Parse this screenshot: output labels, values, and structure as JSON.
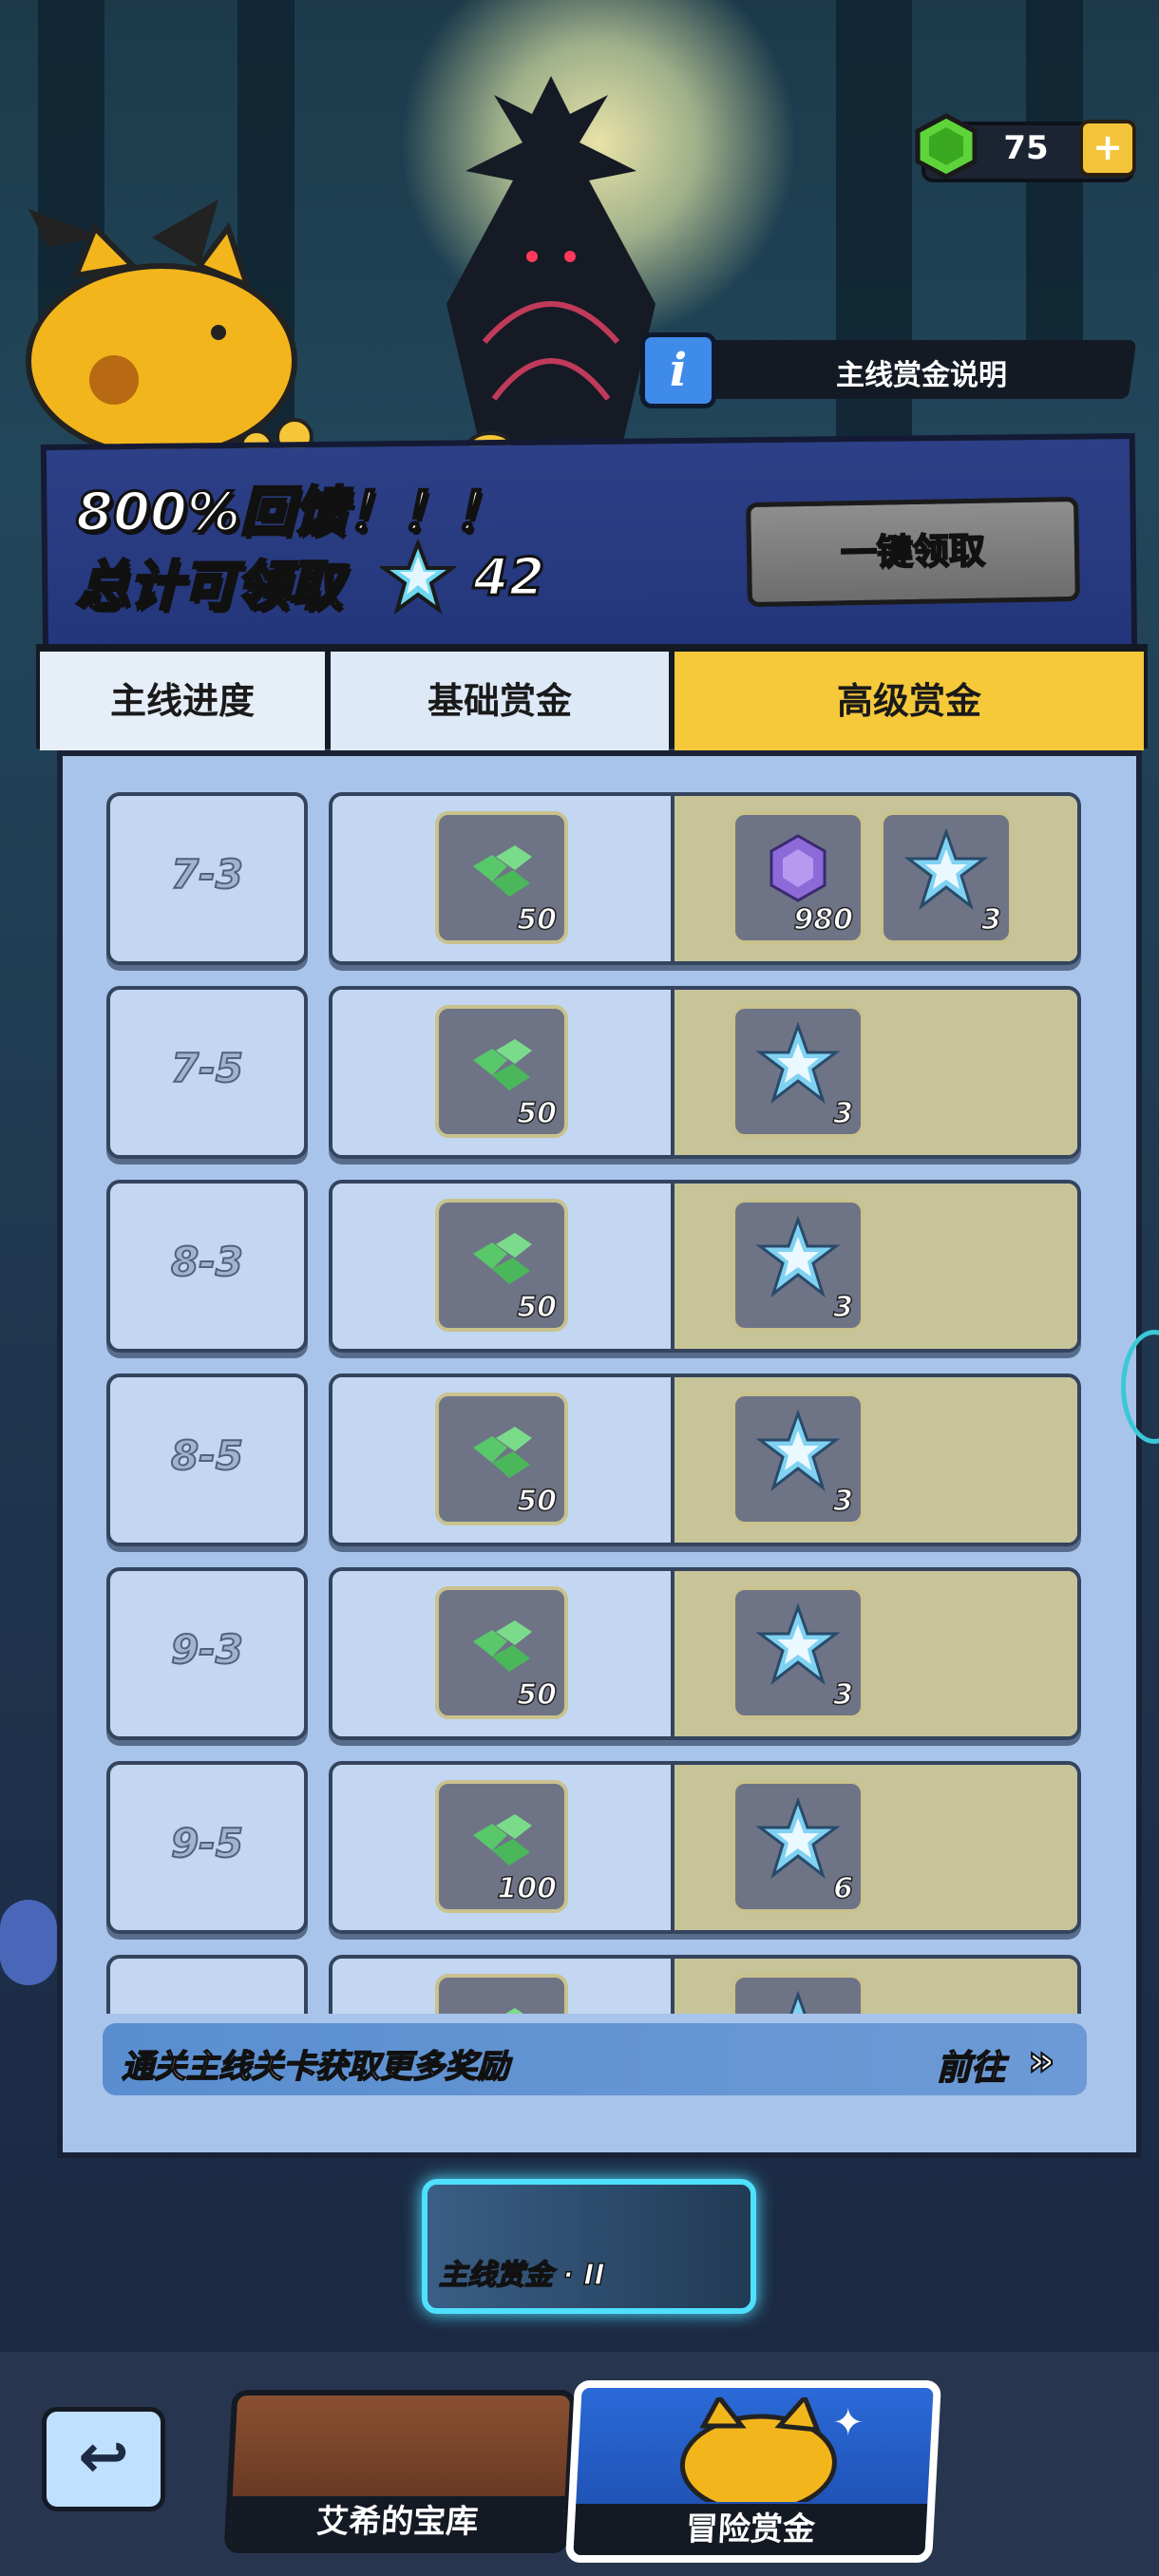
{
  "currency": {
    "gem_count": "75",
    "add_icon": "plus-icon"
  },
  "info": {
    "label": "主线赏金说明",
    "icon": "info-icon"
  },
  "header": {
    "headline": "800%回馈！！！",
    "total_label": "总计可领取",
    "total_value": "42",
    "claim_button": "一键领取"
  },
  "tabs": [
    {
      "label": "主线进度"
    },
    {
      "label": "基础赏金"
    },
    {
      "label": "高级赏金"
    }
  ],
  "rows": [
    {
      "stage": "7-3",
      "basic": [
        {
          "icon": "green-gem-icon",
          "count": "50"
        }
      ],
      "advanced": [
        {
          "icon": "purple-rune-icon",
          "count": "980"
        },
        {
          "icon": "crystal-star-icon",
          "count": "3"
        }
      ]
    },
    {
      "stage": "7-5",
      "basic": [
        {
          "icon": "green-gem-icon",
          "count": "50"
        }
      ],
      "advanced": [
        {
          "icon": "crystal-star-icon",
          "count": "3"
        }
      ]
    },
    {
      "stage": "8-3",
      "basic": [
        {
          "icon": "green-gem-icon",
          "count": "50"
        }
      ],
      "advanced": [
        {
          "icon": "crystal-star-icon",
          "count": "3"
        }
      ]
    },
    {
      "stage": "8-5",
      "basic": [
        {
          "icon": "green-gem-icon",
          "count": "50"
        }
      ],
      "advanced": [
        {
          "icon": "crystal-star-icon",
          "count": "3"
        }
      ]
    },
    {
      "stage": "9-3",
      "basic": [
        {
          "icon": "green-gem-icon",
          "count": "50"
        }
      ],
      "advanced": [
        {
          "icon": "crystal-star-icon",
          "count": "3"
        }
      ]
    },
    {
      "stage": "9-5",
      "basic": [
        {
          "icon": "green-gem-icon",
          "count": "100"
        }
      ],
      "advanced": [
        {
          "icon": "crystal-star-icon",
          "count": "6"
        }
      ]
    },
    {
      "stage": "",
      "basic": [
        {
          "icon": "green-gem-icon",
          "count": ""
        }
      ],
      "advanced": [
        {
          "icon": "crystal-star-icon",
          "count": ""
        }
      ]
    }
  ],
  "footer": {
    "hint": "通关主线关卡获取更多奖励",
    "goto_label": "前往",
    "goto_icon": "double-chevron-right-icon"
  },
  "mode_thumb": {
    "label": "主线赏金 · II"
  },
  "bottom_nav": {
    "back_icon": "back-arrow-icon",
    "items": [
      {
        "label": "艾希的宝库"
      },
      {
        "label": "冒险赏金"
      }
    ]
  }
}
